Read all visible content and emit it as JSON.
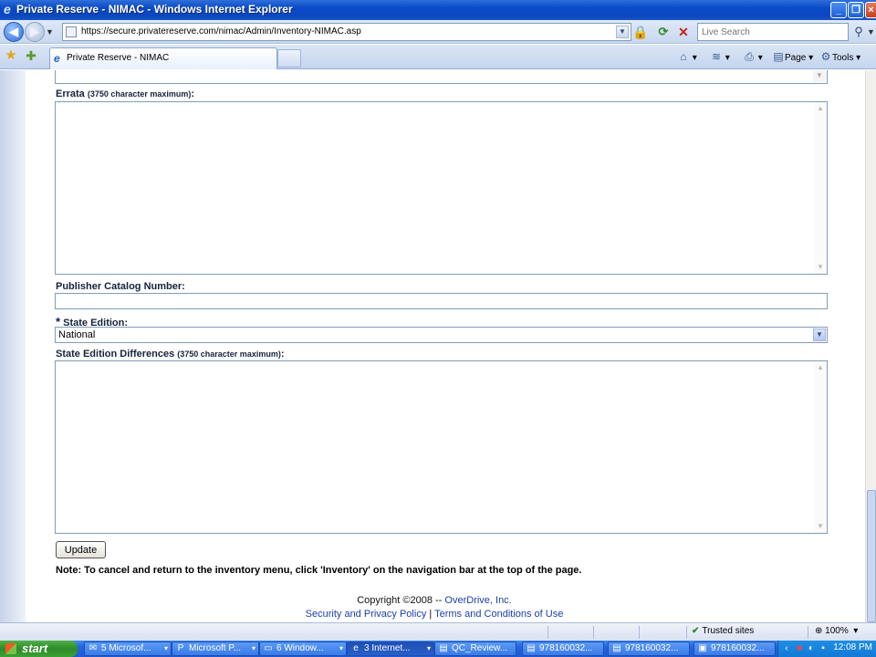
{
  "window": {
    "title": "Private Reserve - NIMAC - Windows Internet Explorer"
  },
  "address": {
    "url": "https://secure.privatereserve.com/nimac/Admin/Inventory-NIMAC.asp",
    "search_placeholder": "Live Search"
  },
  "tab": {
    "label": "Private Reserve - NIMAC"
  },
  "toolbar": {
    "page_label": "Page",
    "tools_label": "Tools"
  },
  "form": {
    "errata_label": "Errata",
    "errata_hint": "(3750 character maximum)",
    "errata_value": "",
    "catalog_label": "Publisher Catalog Number:",
    "catalog_value": "",
    "required_marker": "*",
    "state_edition_label": "State Edition:",
    "state_edition_value": "National",
    "differences_label": "State Edition Differences",
    "differences_hint": "(3750 character maximum)",
    "differences_value": "",
    "colon": ":",
    "update_label": "Update",
    "note": "Note: To cancel and return to the inventory menu, click 'Inventory' on the navigation bar at the top of the page."
  },
  "footer": {
    "copyright_prefix": "Copyright ©2008 --",
    "company_link": "OverDrive, Inc.",
    "privacy_link": "Security and Privacy Policy",
    "separator": "|",
    "terms_link": "Terms and Conditions of Use"
  },
  "status": {
    "zone": "Trusted sites",
    "zoom": "100%"
  },
  "taskbar": {
    "start_label": "start",
    "tasks": [
      {
        "label": "5 Microsof...",
        "icon": "outlook-icon"
      },
      {
        "label": "Microsoft P...",
        "icon": "powerpoint-icon"
      },
      {
        "label": "6 Window...",
        "icon": "folder-icon"
      },
      {
        "label": "3 Internet...",
        "icon": "ie-icon"
      },
      {
        "label": "QC_Review...",
        "icon": "document-icon"
      },
      {
        "label": "978160032...",
        "icon": "document-icon"
      },
      {
        "label": "978160032...",
        "icon": "document-icon"
      },
      {
        "label": "978160032...",
        "icon": "pdf-icon"
      }
    ],
    "clock": "12:08 PM"
  }
}
